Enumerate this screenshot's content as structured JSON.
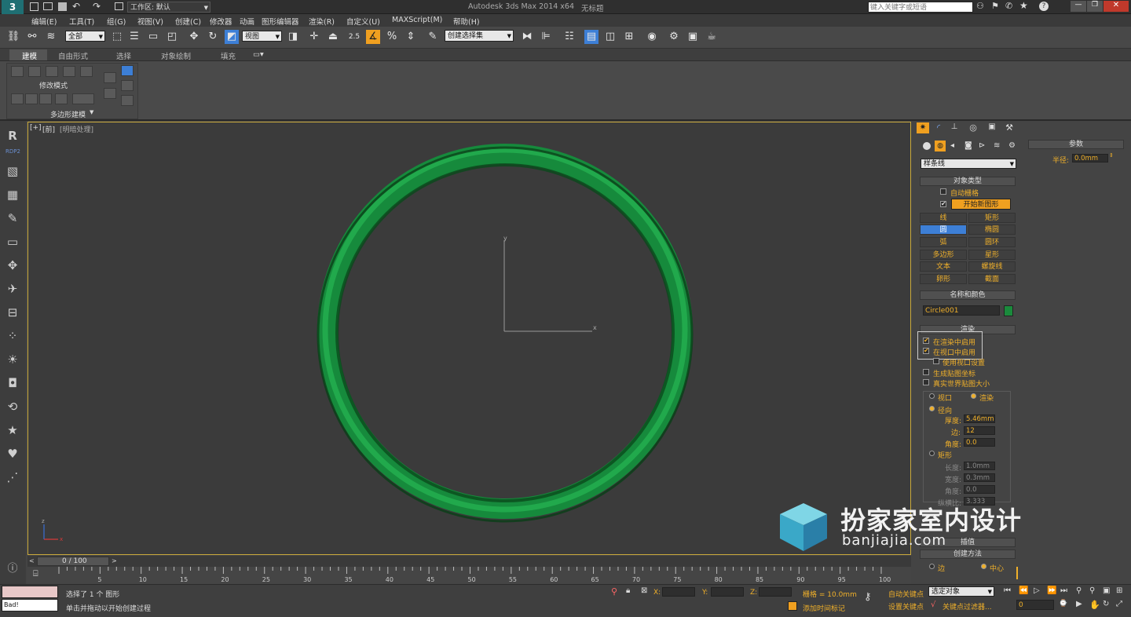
{
  "titlebar": {
    "workspace": "工作区: 默认",
    "title": "Autodesk 3ds Max  2014 x64",
    "filename": "无标题",
    "search_placeholder": "键入关键字或短语"
  },
  "menu": [
    "编辑(E)",
    "工具(T)",
    "组(G)",
    "视图(V)",
    "创建(C)",
    "修改器",
    "动画",
    "图形编辑器",
    "渲染(R)",
    "自定义(U)",
    "MAXScript(M)",
    "帮助(H)"
  ],
  "toolbar": {
    "selection_filter": "全部",
    "ref_coord": "视图",
    "snap_label": "2.5",
    "named_selection": "创建选择集"
  },
  "ribbon": {
    "tabs": [
      "建模",
      "自由形式",
      "选择",
      "对象绘制",
      "填充"
    ],
    "group_label": "修改模式",
    "panel_label": "多边形建模"
  },
  "viewport": {
    "label_plus": "[+]",
    "label_view": "前",
    "label_shading": "明暗处理",
    "axis_y": "y",
    "axis_x": "x",
    "axis_z": "z"
  },
  "command_panel": {
    "category_dropdown": "样条线",
    "object_type": {
      "header": "对象类型",
      "auto_grid": "自动栅格",
      "start_new_shape": "开始新图形",
      "buttons": [
        "线",
        "矩形",
        "圆",
        "椭圆",
        "弧",
        "圆环",
        "多边形",
        "星形",
        "文本",
        "螺旋线",
        "卵形",
        "截面"
      ]
    },
    "name_color": {
      "header": "名称和颜色",
      "name": "Circle001",
      "color": "#1a8a3c"
    },
    "rendering": {
      "header": "渲染",
      "enable_render": "在渲染中启用",
      "enable_viewport": "在视口中启用",
      "use_viewport_settings": "使用视口设置",
      "gen_mapping": "生成贴图坐标",
      "real_world": "真实世界贴图大小",
      "viewport_radio": "视口",
      "render_radio": "渲染",
      "radial": "径向",
      "thickness_label": "厚度:",
      "thickness": "5.46mm",
      "sides_label": "边:",
      "sides": "12",
      "angle_label": "角度:",
      "angle": "0.0",
      "rectangular": "矩形",
      "length_label": "长度:",
      "length": "1.0mm",
      "width_label": "宽度:",
      "width": "0.3mm",
      "angle2_label": "角度:",
      "angle2": "0.0",
      "aspect_label": "纵横比:",
      "aspect": "3.333"
    },
    "interpolation_header": "插值",
    "creation": {
      "header": "创建方法",
      "edge": "边",
      "center": "中心"
    }
  },
  "params": {
    "header": "参数",
    "radius_label": "半径:",
    "radius": "0.0mm"
  },
  "timeline": {
    "frame": "0 / 100",
    "ticks": [
      "5",
      "10",
      "15",
      "20",
      "25",
      "30",
      "35",
      "40",
      "45",
      "50",
      "55",
      "60",
      "65",
      "70",
      "75",
      "80",
      "85",
      "90",
      "95",
      "100"
    ]
  },
  "status": {
    "selected": "选择了 1 个 图形",
    "prompt": "单击并拖动以开始创建过程",
    "script_out": "Bad!",
    "x_label": "X:",
    "y_label": "Y:",
    "z_label": "Z:",
    "grid": "栅格 = 10.0mm",
    "add_time_tag": "添加时间标记",
    "auto_key": "自动关键点",
    "set_key": "设置关键点",
    "selection_set": "选定对象",
    "key_filters": "关键点过滤器...",
    "frame_field": "0"
  },
  "watermark": {
    "cn": "扮家家室内设计",
    "url": "banjiajia.com"
  },
  "colors": {
    "accent": "#f0b02a",
    "selected_button": "#3d7fd6",
    "ring": "#168a3c"
  }
}
